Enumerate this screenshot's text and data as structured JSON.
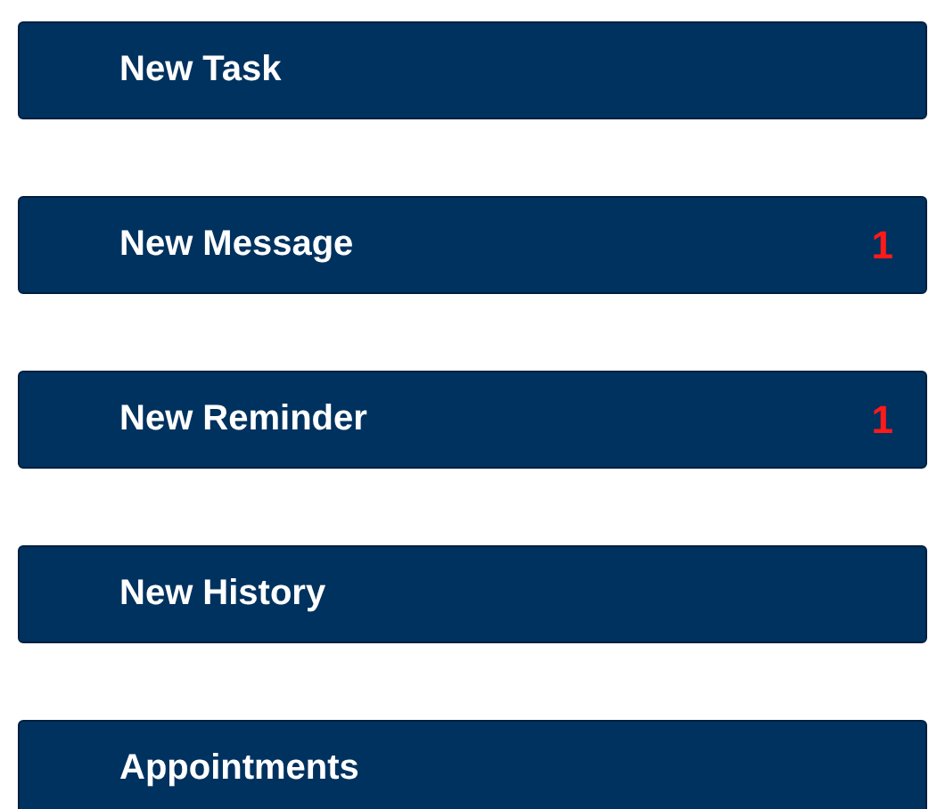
{
  "menu_items": [
    {
      "label": "New Task"
    },
    {
      "label": "New Message",
      "count": "1"
    },
    {
      "label": "New Reminder",
      "count": "1"
    },
    {
      "label": "New History"
    },
    {
      "label": "Appointments"
    }
  ]
}
